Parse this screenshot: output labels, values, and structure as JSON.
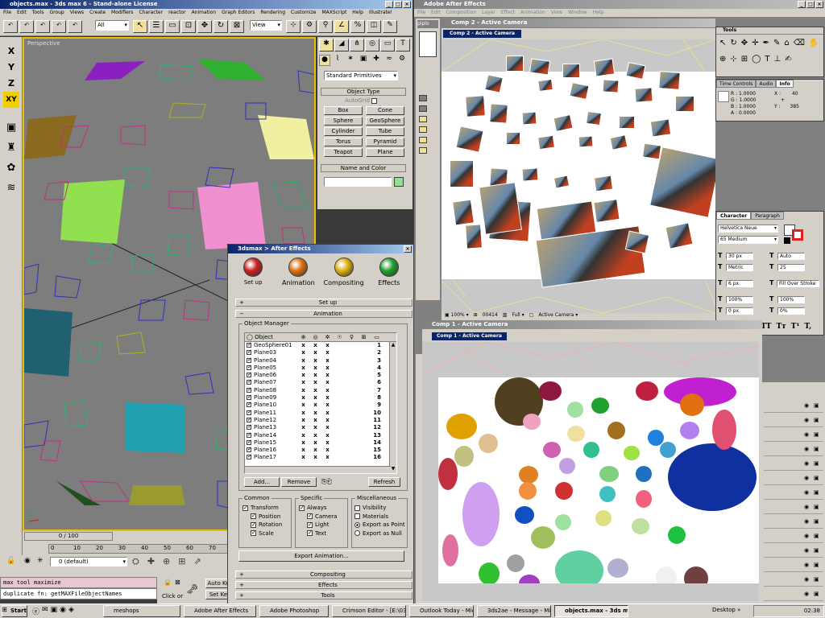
{
  "max": {
    "title": "objects.max - 3ds max 6 - Stand-alone License",
    "menu": [
      "File",
      "Edit",
      "Tools",
      "Group",
      "Views",
      "Create",
      "Modifiers",
      "Character",
      "reactor",
      "Animation",
      "Graph Editors",
      "Rendering",
      "Customize",
      "MAXScript",
      "Help",
      "Illustrate!"
    ],
    "selection_filter": "All",
    "ref_coord": "View",
    "viewport_label": "Perspective",
    "axis_buttons": [
      "X",
      "Y",
      "Z",
      "XY"
    ],
    "dropdown_category": "Standard Primitives",
    "object_type_title": "Object Type",
    "autogrid": "AutoGrid",
    "primitives": [
      "Box",
      "Cone",
      "Sphere",
      "GeoSphere",
      "Cylinder",
      "Tube",
      "Torus",
      "Pyramid",
      "Teapot",
      "Plane"
    ],
    "name_color_title": "Name and Color",
    "frame_counter": "0 / 100",
    "timeline_ticks": [
      "0",
      "10",
      "20",
      "30",
      "40",
      "50",
      "60",
      "70"
    ],
    "layer": "0 (default)",
    "listener_line1": "max tool maximize",
    "listener_line2": "duplicate fn: getMAXFileObjectNames",
    "click_or": "Click or",
    "auto_key": "Auto Ke",
    "set_key": "Set Ke"
  },
  "plugin": {
    "title": "3dsmax > After Effects",
    "buttons": [
      {
        "label": "Set up",
        "color": "#cc2020"
      },
      {
        "label": "Animation",
        "color": "#e07010"
      },
      {
        "label": "Compositing",
        "color": "#e0b010"
      },
      {
        "label": "Effects",
        "color": "#20a030"
      }
    ],
    "rollout_setup": "Set up",
    "rollout_animation": "Animation",
    "object_manager": "Object Manager",
    "col_object": "Object",
    "objects": [
      {
        "name": "GeoSphere01",
        "n": "1"
      },
      {
        "name": "Plane03",
        "n": "2"
      },
      {
        "name": "Plane04",
        "n": "3"
      },
      {
        "name": "Plane05",
        "n": "4"
      },
      {
        "name": "Plane06",
        "n": "5"
      },
      {
        "name": "Plane07",
        "n": "6"
      },
      {
        "name": "Plane08",
        "n": "7"
      },
      {
        "name": "Plane09",
        "n": "8"
      },
      {
        "name": "Plane10",
        "n": "9"
      },
      {
        "name": "Plane11",
        "n": "10"
      },
      {
        "name": "Plane12",
        "n": "11"
      },
      {
        "name": "Plane13",
        "n": "12"
      },
      {
        "name": "Plane14",
        "n": "13"
      },
      {
        "name": "Plane15",
        "n": "14"
      },
      {
        "name": "Plane16",
        "n": "15"
      },
      {
        "name": "Plane17",
        "n": "16"
      }
    ],
    "x_mark": "x",
    "add": "Add...",
    "remove": "Remove",
    "refresh": "Refresh",
    "common": {
      "title": "Common",
      "items": [
        "Transform",
        "Position",
        "Rotation",
        "Scale"
      ]
    },
    "specific": {
      "title": "Specific",
      "items": [
        "Always",
        "Camera",
        "Light",
        "Text"
      ]
    },
    "misc": {
      "title": "Miscellaneous",
      "items": [
        "Visibility",
        "Materials",
        "Export as Point",
        "Export as Null"
      ]
    },
    "export": "Export Animation...",
    "rollout_compositing": "Compositing",
    "rollout_effects": "Effects",
    "rollout_tools": "Tools"
  },
  "ae": {
    "title": "Adobe After Effects",
    "menu": [
      "File",
      "Edit",
      "Composition",
      "Layer",
      "Effect",
      "Animation",
      "View",
      "Window",
      "Help"
    ],
    "project_tab": "piplo",
    "comp2_title": "Comp 2 - Active Camera",
    "comp2_tab": "Comp 2 - Active Camera",
    "comp1_title": "Comp 1 - Active Camera",
    "comp1_tab": "Comp 1 - Active Camera",
    "zoom": "100%",
    "timecode": "00414",
    "resolution": "Full",
    "camera": "Active Camera",
    "tools_title": "Tools",
    "info_tabs": [
      "Time Controls",
      "Audio",
      "Info"
    ],
    "info_r": "R : 1.0000",
    "info_g": "G : 1.0000",
    "info_b": "B : 1.0000",
    "info_a": "A : 0.0000",
    "info_x": "X :",
    "info_y": "Y :",
    "info_xv": "40",
    "info_yv": "385",
    "char_tabs": [
      "Character",
      "Paragraph"
    ],
    "font": "Helvetica Neue",
    "style": "65 Medium",
    "size": "30 px",
    "leading": "Auto",
    "kerning": "Metric",
    "tracking": "25",
    "stroke": "6 px",
    "stroke_type": "Fill Over Stroke",
    "vscale": "100%",
    "hscale": "100%",
    "baseline": "0 px",
    "tsume": "0%",
    "text_styles": [
      "T",
      "T",
      "TT",
      "Tт",
      "T¹",
      "T,"
    ]
  },
  "taskbar": {
    "start": "Start",
    "tasks": [
      "meshops",
      "Adobe After Effects",
      "Adobe Photoshop",
      "Crimson Editor - [E:\\03_Sc...",
      "Outlook Today - Microsoft ...",
      "3ds2ae - Message - Micros...",
      "objects.max - 3ds max..."
    ],
    "desktop": "Desktop",
    "clock": "02:38"
  },
  "colors": {
    "xp_blue": "#0a246a",
    "viewport_bg": "#7d7d7d",
    "selected_row": "#0a246a"
  }
}
